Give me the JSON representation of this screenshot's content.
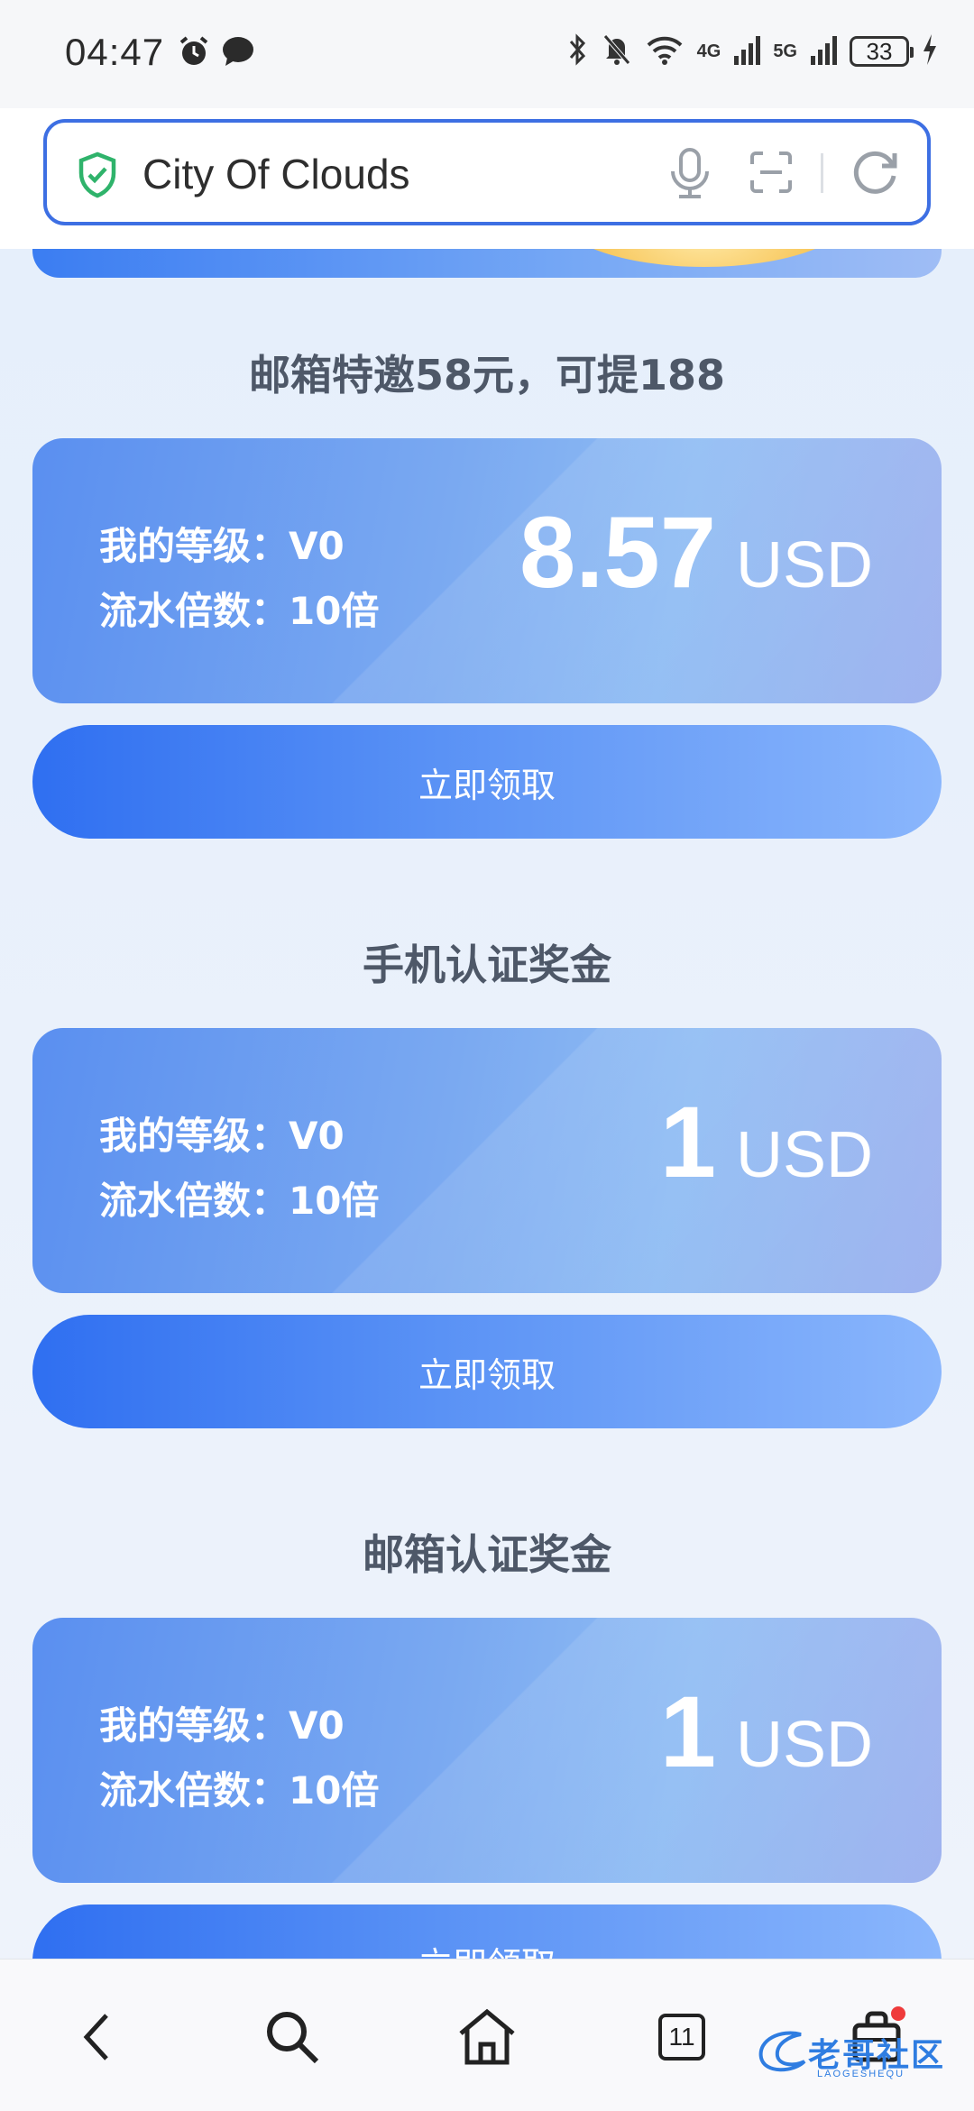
{
  "status_bar": {
    "time": "04:47",
    "network_a": "4G",
    "network_b": "5G",
    "battery": "33"
  },
  "address_bar": {
    "title": "City Of Clouds"
  },
  "sections": [
    {
      "title": "邮箱特邀58元，可提188",
      "level": "我的等级：V0",
      "multiplier": "流水倍数：10倍",
      "amount": "8.57",
      "unit": "USD",
      "button": "立即领取"
    },
    {
      "title": "手机认证奖金",
      "level": "我的等级：V0",
      "multiplier": "流水倍数：10倍",
      "amount": "1",
      "unit": "USD",
      "button": "立即领取"
    },
    {
      "title": "邮箱认证奖金",
      "level": "我的等级：V0",
      "multiplier": "流水倍数：10倍",
      "amount": "1",
      "unit": "USD",
      "button": "立即领取"
    }
  ],
  "bottom_nav": {
    "tab_count": "11"
  },
  "watermark": {
    "text": "老哥社区",
    "sub": "LAOGESHEQU"
  },
  "icons": {
    "status_left": [
      "alarm-icon",
      "message-icon"
    ],
    "status_right": [
      "bluetooth-icon",
      "mute-icon",
      "wifi-icon",
      "signal-icon",
      "signal-icon",
      "battery-icon",
      "charging-icon"
    ],
    "address_bar": [
      "shield-check-icon",
      "microphone-icon",
      "scan-icon",
      "reload-icon"
    ],
    "bottom_nav": [
      "back-icon",
      "search-icon",
      "home-icon",
      "tabs-icon",
      "bag-icon"
    ]
  },
  "colors": {
    "accent": "#3d6fe3",
    "shield": "#2fb36b",
    "badge": "#ef3b3b"
  }
}
